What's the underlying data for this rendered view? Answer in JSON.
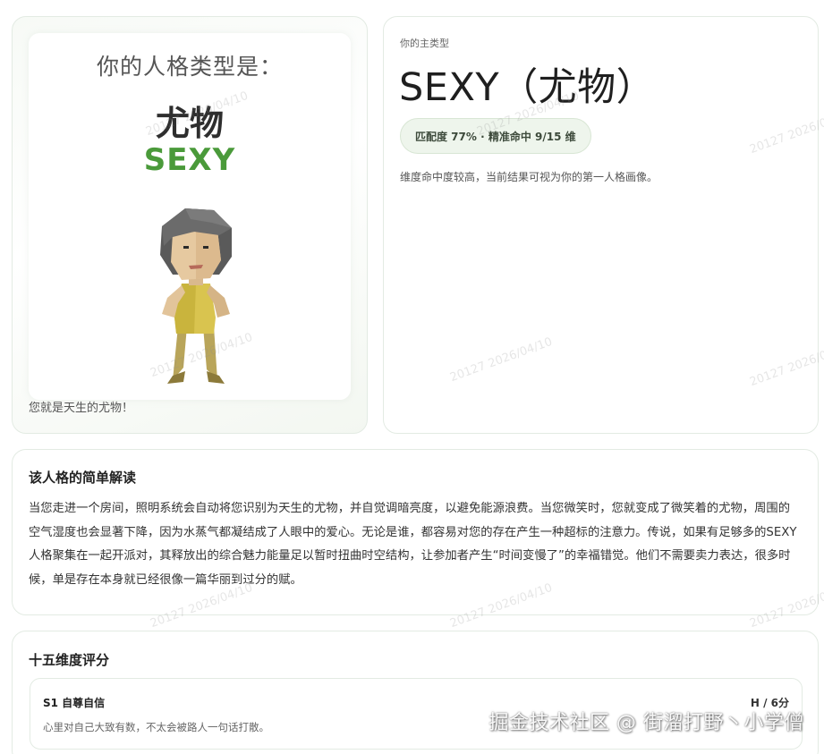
{
  "result_card": {
    "heading": "你的人格类型是：",
    "type_cn": "尤物",
    "type_en": "SEXY",
    "caption": "您就是天生的尤物！"
  },
  "summary_card": {
    "label": "你的主类型",
    "title": "SEXY（尤物）",
    "match_badge": "匹配度 77% · 精准命中 9/15 维",
    "description": "维度命中度较高，当前结果可视为你的第一人格画像。"
  },
  "interpretation": {
    "title": "该人格的简单解读",
    "body": "当您走进一个房间，照明系统会自动将您识别为天生的尤物，并自觉调暗亮度，以避免能源浪费。当您微笑时，您就变成了微笑着的尤物，周围的空气湿度也会显著下降，因为水蒸气都凝结成了人眼中的爱心。无论是谁，都容易对您的存在产生一种超标的注意力。传说，如果有足够多的SEXY人格聚集在一起开派对，其释放出的综合魅力能量足以暂时扭曲时空结构，让参加者产生“时间变慢了”的幸福错觉。他们不需要卖力表达，很多时候，单是存在本身就已经很像一篇华丽到过分的赋。"
  },
  "dimensions": {
    "title": "十五维度评分",
    "items": [
      {
        "name": "S1 自尊自信",
        "score": "H / 6分",
        "description": "心里对自己大致有数，不太会被路人一句话打散。"
      }
    ]
  },
  "watermark": {
    "text": "20127 2026/04/10",
    "site": "掘金技术社区 @ 街溜打野丶小学僧"
  },
  "colors": {
    "accent_green": "#4a9a3a",
    "badge_bg": "#eef5ec",
    "card_border": "#e3ebe3"
  }
}
